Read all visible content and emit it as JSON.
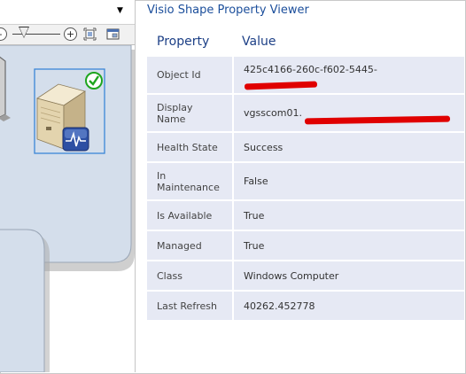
{
  "viewer": {
    "title": "Visio Shape Property Viewer",
    "header_property": "Property",
    "header_value": "Value",
    "rows": [
      {
        "property": "Object Id",
        "value": "425c4166-260c-f602-5445-"
      },
      {
        "property": "Display Name",
        "value": "vgsscom01."
      },
      {
        "property": "Health State",
        "value": "Success"
      },
      {
        "property": "In Maintenance",
        "value": "False"
      },
      {
        "property": "Is Available",
        "value": "True"
      },
      {
        "property": "Managed",
        "value": "True"
      },
      {
        "property": "Class",
        "value": "Windows Computer"
      },
      {
        "property": "Last Refresh",
        "value": "40262.452778"
      }
    ]
  },
  "toolbar": {
    "zoom_out_symbol": "-",
    "zoom_in_symbol": "+"
  },
  "colors": {
    "title": "#1b4e9b",
    "row_background": "#e6e9f4",
    "selection": "#3b86d6",
    "health_ok": "#1ea51e",
    "redaction": "#e00000"
  }
}
